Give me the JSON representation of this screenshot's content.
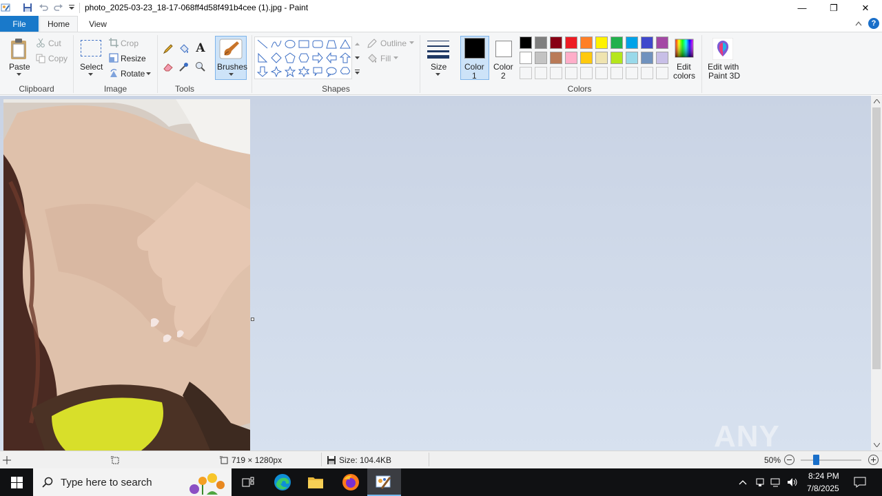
{
  "window": {
    "title": "photo_2025-03-23_18-17-068ff4d58f491b4cee (1).jpg - Paint",
    "minimize": "—",
    "restore": "❐",
    "close": "✕"
  },
  "tabs": {
    "file": "File",
    "home": "Home",
    "view": "View"
  },
  "clipboard": {
    "paste": "Paste",
    "cut": "Cut",
    "copy": "Copy",
    "group": "Clipboard"
  },
  "image": {
    "select": "Select",
    "crop": "Crop",
    "resize": "Resize",
    "rotate": "Rotate",
    "group": "Image"
  },
  "tools": {
    "group": "Tools"
  },
  "brushes": {
    "label": "Brushes"
  },
  "shapes": {
    "outline": "Outline",
    "fill": "Fill",
    "group": "Shapes"
  },
  "size": {
    "label": "Size"
  },
  "colors": {
    "color1": "Color",
    "color1_num": "1",
    "color2": "Color",
    "color2_num": "2",
    "edit": "Edit",
    "edit2": "colors",
    "paint3d": "Edit with",
    "paint3d2": "Paint 3D",
    "group": "Colors",
    "active_color1": "#000000",
    "active_color2": "#ffffff",
    "palette_row1": [
      "#000000",
      "#7f7f7f",
      "#880015",
      "#ed1c24",
      "#ff7f27",
      "#fff200",
      "#22b14c",
      "#00a2e8",
      "#3f48cc",
      "#a349a4"
    ],
    "palette_row2": [
      "#ffffff",
      "#c3c3c3",
      "#b97a57",
      "#ffaec9",
      "#ffc90e",
      "#efe4b0",
      "#b5e61d",
      "#99d9ea",
      "#7092be",
      "#c8bfe7"
    ]
  },
  "status": {
    "dimensions": "719 × 1280px",
    "size": "Size: 104.4KB",
    "zoom": "50%"
  },
  "taskbar": {
    "search_placeholder": "Type here to search",
    "time": "8:24 PM",
    "date": "7/8/2025"
  },
  "watermark": "ANY RUN"
}
